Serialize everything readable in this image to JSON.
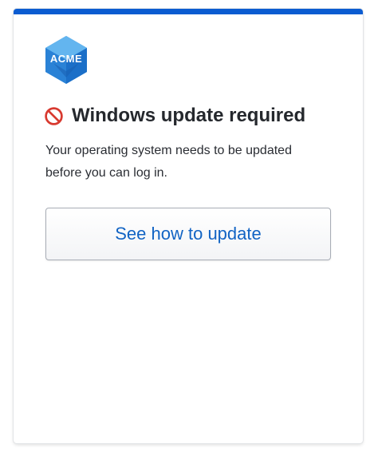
{
  "logo": {
    "text": "ACME",
    "icon": "acme-hexagon-logo",
    "colors": {
      "light": "#5fb2ee",
      "mid": "#2f8ee0",
      "dark": "#1b6fc8"
    }
  },
  "header": {
    "icon": "no-entry-icon",
    "icon_color": "#d83a30",
    "title": "Windows update required"
  },
  "message": {
    "line1": "Your operating system needs to be updated",
    "line2": "before you can log in."
  },
  "actions": {
    "update_button_label": "See how to update"
  },
  "colors": {
    "accent_bar": "#0b5cd1",
    "link_blue": "#1264c4",
    "text_dark": "#25282d"
  }
}
